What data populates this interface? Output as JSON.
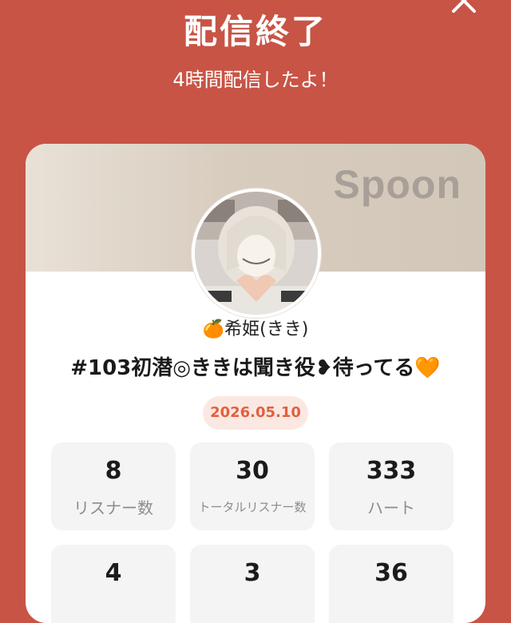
{
  "header": {
    "title": "配信終了",
    "subtitle": "4時間配信したよ！",
    "close_icon": "close-icon"
  },
  "card": {
    "brand": "Spoon",
    "avatar_icon": "profile-avatar",
    "username": "🍊希姫(きき)",
    "live_title": "#103初潜◎ききは聞き役❥待ってる🧡",
    "date": "2026.05.10",
    "stats": [
      {
        "value": "8",
        "label": "リスナー数"
      },
      {
        "value": "30",
        "label": "トータルリスナー数"
      },
      {
        "value": "333",
        "label": "ハート"
      },
      {
        "value": "4",
        "label": ""
      },
      {
        "value": "3",
        "label": ""
      },
      {
        "value": "36",
        "label": ""
      }
    ]
  },
  "colors": {
    "background": "#c85445",
    "card": "#ffffff",
    "badge_bg": "#fce8e2",
    "badge_text": "#e2603f",
    "stat_bg": "#f4f4f4"
  }
}
